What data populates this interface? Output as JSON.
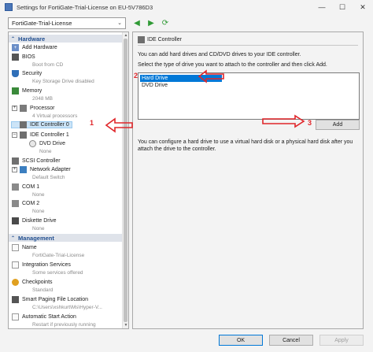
{
  "window": {
    "title": "Settings for FortiGate-Trial-License on EU-5V786D3",
    "minimize_icon": "minimize-icon",
    "maximize_icon": "maximize-icon",
    "close_icon": "close-icon"
  },
  "vm_selector": {
    "value": "FortiGate-Trial-License"
  },
  "tree": {
    "hardware_header": "Hardware",
    "management_header": "Management",
    "hardware_items": [
      {
        "label": "Add Hardware",
        "sub": ""
      },
      {
        "label": "BIOS",
        "sub": "Boot from CD"
      },
      {
        "label": "Security",
        "sub": "Key Storage Drive disabled"
      },
      {
        "label": "Memory",
        "sub": "2048 MB"
      },
      {
        "label": "Processor",
        "sub": "4 Virtual processors"
      },
      {
        "label": "IDE Controller 0",
        "sub": ""
      },
      {
        "label": "IDE Controller 1",
        "sub": ""
      },
      {
        "label": "DVD Drive",
        "sub": "None"
      },
      {
        "label": "SCSI Controller",
        "sub": ""
      },
      {
        "label": "Network Adapter",
        "sub": "Default Switch"
      },
      {
        "label": "COM 1",
        "sub": "None"
      },
      {
        "label": "COM 2",
        "sub": "None"
      },
      {
        "label": "Diskette Drive",
        "sub": "None"
      }
    ],
    "management_items": [
      {
        "label": "Name",
        "sub": "FortiGate-Trial-License"
      },
      {
        "label": "Integration Services",
        "sub": "Some services offered"
      },
      {
        "label": "Checkpoints",
        "sub": "Standard"
      },
      {
        "label": "Smart Paging File Location",
        "sub": "C:\\Users\\xshkurt\\Ms\\Hyper-V..."
      },
      {
        "label": "Automatic Start Action",
        "sub": "Restart if previously running"
      }
    ]
  },
  "detail": {
    "header": "IDE Controller",
    "intro": "You can add hard drives and CD/DVD drives to your IDE controller.",
    "select_prompt": "Select the type of drive you want to attach to the controller and then click Add.",
    "drive_options": [
      "Hard Drive",
      "DVD Drive"
    ],
    "selected_drive": "Hard Drive",
    "add_label": "Add",
    "footer": "You can configure a hard drive to use a virtual hard disk or a physical hard disk after you attach the drive to the controller."
  },
  "buttons": {
    "ok": "OK",
    "cancel": "Cancel",
    "apply": "Apply"
  },
  "annotations": {
    "one": "1",
    "two": "2",
    "three": "3",
    "color": "#e0262a"
  }
}
